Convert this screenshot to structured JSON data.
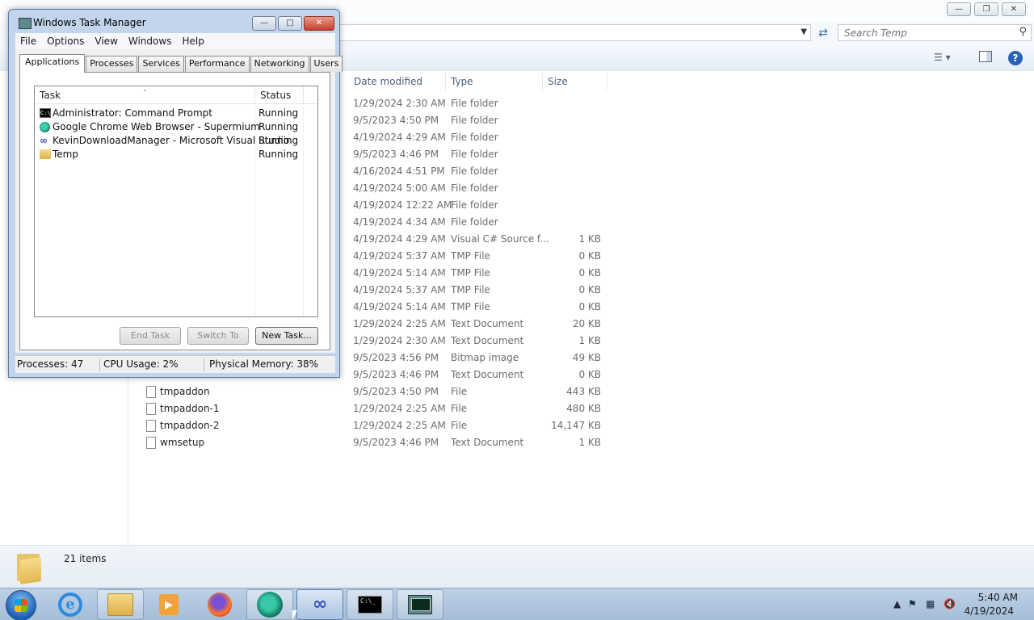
{
  "explorer": {
    "search_placeholder": "Search Temp",
    "columns": {
      "date": "Date modified",
      "type": "Type",
      "size": "Size"
    },
    "rows": [
      {
        "name": "",
        "date": "1/29/2024 2:30 AM",
        "type": "File folder",
        "size": ""
      },
      {
        "name": "",
        "date": "9/5/2023 4:50 PM",
        "type": "File folder",
        "size": ""
      },
      {
        "name": "",
        "date": "4/19/2024 4:29 AM",
        "type": "File folder",
        "size": ""
      },
      {
        "name": "",
        "date": "9/5/2023 4:46 PM",
        "type": "File folder",
        "size": ""
      },
      {
        "name": "",
        "date": "4/16/2024 4:51 PM",
        "type": "File folder",
        "size": ""
      },
      {
        "name": "",
        "date": "4/19/2024 5:00 AM",
        "type": "File folder",
        "size": ""
      },
      {
        "name": "",
        "date": "4/19/2024 12:22 AM",
        "type": "File folder",
        "size": ""
      },
      {
        "name": "",
        "date": "4/19/2024 4:34 AM",
        "type": "File folder",
        "size": ""
      },
      {
        "name": "",
        "date": "4/19/2024 4:29 AM",
        "type": "Visual C# Source f...",
        "size": "1 KB"
      },
      {
        "name": "",
        "date": "4/19/2024 5:37 AM",
        "type": "TMP File",
        "size": "0 KB"
      },
      {
        "name": "",
        "date": "4/19/2024 5:14 AM",
        "type": "TMP File",
        "size": "0 KB"
      },
      {
        "name": "",
        "date": "4/19/2024 5:37 AM",
        "type": "TMP File",
        "size": "0 KB"
      },
      {
        "name": "",
        "date": "4/19/2024 5:14 AM",
        "type": "TMP File",
        "size": "0 KB"
      },
      {
        "name": "",
        "date": "1/29/2024 2:25 AM",
        "type": "Text Document",
        "size": "20 KB"
      },
      {
        "name": "",
        "date": "1/29/2024 2:30 AM",
        "type": "Text Document",
        "size": "1 KB"
      },
      {
        "name": "",
        "date": "9/5/2023 4:56 PM",
        "type": "Bitmap image",
        "size": "49 KB"
      },
      {
        "name": "",
        "date": "9/5/2023 4:46 PM",
        "type": "Text Document",
        "size": "0 KB"
      },
      {
        "name": "tmpaddon",
        "date": "9/5/2023 4:50 PM",
        "type": "File",
        "size": "443 KB"
      },
      {
        "name": "tmpaddon-1",
        "date": "1/29/2024 2:25 AM",
        "type": "File",
        "size": "480 KB"
      },
      {
        "name": "tmpaddon-2",
        "date": "1/29/2024 2:25 AM",
        "type": "File",
        "size": "14,147 KB"
      },
      {
        "name": "wmsetup",
        "date": "9/5/2023 4:46 PM",
        "type": "Text Document",
        "size": "1 KB"
      }
    ],
    "status": "21 items"
  },
  "task_manager": {
    "title": "Windows Task Manager",
    "menu": [
      "File",
      "Options",
      "View",
      "Windows",
      "Help"
    ],
    "tabs": [
      "Applications",
      "Processes",
      "Services",
      "Performance",
      "Networking",
      "Users"
    ],
    "selected_tab": "Applications",
    "columns": {
      "task": "Task",
      "status": "Status"
    },
    "tasks": [
      {
        "name": "Administrator:  Command Prompt",
        "status": "Running",
        "icon": "cmd-icon"
      },
      {
        "name": "Google Chrome Web Browser - Supermium",
        "status": "Running",
        "icon": "supermium-icon"
      },
      {
        "name": "KevinDownloadManager - Microsoft Visual Studio",
        "status": "Running",
        "icon": "visual-studio-icon"
      },
      {
        "name": "Temp",
        "status": "Running",
        "icon": "folder-icon"
      }
    ],
    "buttons": {
      "end_task": "End Task",
      "switch_to": "Switch To",
      "new_task": "New Task..."
    },
    "statusbar": {
      "processes": "Processes: 47",
      "cpu": "CPU Usage: 2%",
      "memory": "Physical Memory: 38%"
    }
  },
  "taskbar": {
    "time": "5:40 AM",
    "date": "4/19/2024",
    "pinned": [
      "internet-explorer-icon",
      "windows-explorer-icon",
      "media-player-icon",
      "firefox-icon",
      "supermium-icon",
      "visual-studio-icon",
      "command-prompt-icon",
      "task-manager-icon"
    ]
  }
}
